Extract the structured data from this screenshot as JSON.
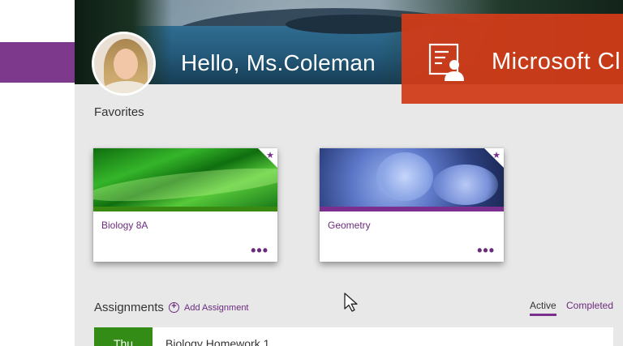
{
  "header": {
    "greeting": "Hello, Ms.Coleman",
    "brand": "Microsoft Cl",
    "brand_color": "#d13c18",
    "icon": "classroom-icon"
  },
  "favorites": {
    "heading": "Favorites",
    "cards": [
      {
        "title": "Biology 8A",
        "more": "•••",
        "star": "★",
        "accent": "#3a8a12"
      },
      {
        "title": "Geometry",
        "more": "•••",
        "star": "★",
        "accent": "#7a2e8e"
      }
    ]
  },
  "assignments": {
    "heading": "Assignments",
    "add_label": "Add Assignment",
    "add_icon": "add-circle-icon",
    "tabs": [
      {
        "label": "Active",
        "selected": true
      },
      {
        "label": "Completed",
        "selected": false
      }
    ],
    "items": [
      {
        "day": "Thu",
        "title": "Biology Homework 1"
      }
    ]
  },
  "accent_color": "#7a2e8e"
}
